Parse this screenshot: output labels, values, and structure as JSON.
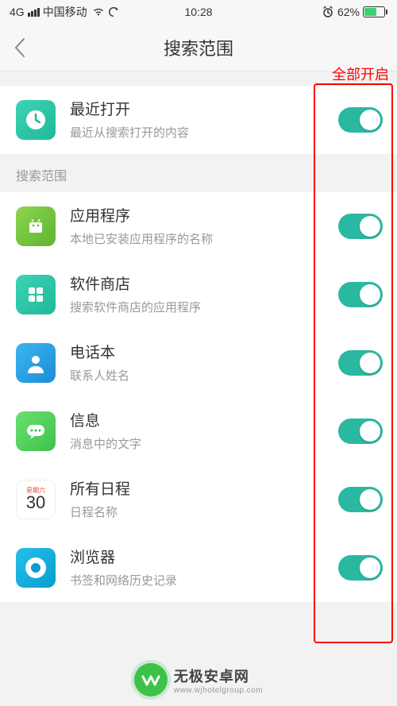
{
  "status": {
    "signal_type": "4G",
    "carrier": "中国移动",
    "time": "10:28",
    "alarm": true,
    "battery_pct": "62%"
  },
  "nav": {
    "title": "搜索范围"
  },
  "annotation": {
    "label": "全部开启"
  },
  "recent": {
    "title": "最近打开",
    "sub": "最近从搜索打开的内容",
    "on": true
  },
  "section_header": "搜索范围",
  "items": [
    {
      "icon": "android",
      "title": "应用程序",
      "sub": "本地已安装应用程序的名称",
      "on": true
    },
    {
      "icon": "store",
      "title": "软件商店",
      "sub": "搜索软件商店的应用程序",
      "on": true
    },
    {
      "icon": "contact",
      "title": "电话本",
      "sub": "联系人姓名",
      "on": true
    },
    {
      "icon": "message",
      "title": "信息",
      "sub": "消息中的文字",
      "on": true
    },
    {
      "icon": "calendar",
      "title": "所有日程",
      "sub": "日程名称",
      "on": true,
      "cal_day": "星期六",
      "cal_num": "30"
    },
    {
      "icon": "browser",
      "title": "浏览器",
      "sub": "书签和网络历史记录",
      "on": true
    }
  ],
  "watermark": {
    "main": "无极安卓网",
    "sub": "www.wjhotelgroup.com"
  }
}
